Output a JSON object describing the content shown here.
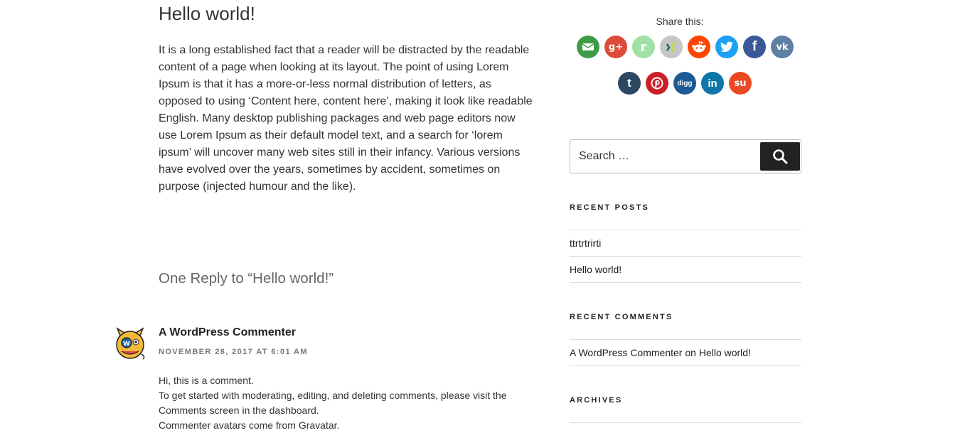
{
  "post": {
    "title": "Hello world!",
    "body": "It is a long established fact that a reader will be distracted by the readable content of a page when looking at its layout. The point of using Lorem Ipsum is that it has a more-or-less normal distribution of letters, as opposed to using ‘Content here, content here’, making it look like readable English. Many desktop publishing packages and web page editors now use Lorem Ipsum as their default model text, and a search for ‘lorem ipsum’ will uncover many web sites still in their infancy. Various versions have evolved over the years, sometimes by accident, sometimes on purpose (injected humour and the like)."
  },
  "comments": {
    "title": "One Reply to “Hello world!”",
    "items": [
      {
        "author": "A WordPress Commenter",
        "date": "November 28, 2017 at 6:01 am",
        "lines": [
          "Hi, this is a comment.",
          "To get started with moderating, editing, and deleting comments, please visit the Comments screen in the dashboard.",
          "Commenter avatars come from Gravatar."
        ]
      }
    ]
  },
  "share": {
    "title": "Share this:",
    "buttons": [
      {
        "name": "email",
        "color": "#3e9b46",
        "glyph": "✉"
      },
      {
        "name": "google-plus",
        "color": "#dd4b39",
        "glyph": "g+"
      },
      {
        "name": "renren",
        "color": "#a2e1a5",
        "glyph": "r"
      },
      {
        "name": "xing",
        "color": "#c6c6c6",
        "glyph": "x"
      },
      {
        "name": "reddit",
        "color": "#ff4500",
        "glyph": "●"
      },
      {
        "name": "twitter",
        "color": "#1da1f2",
        "glyph": "t"
      },
      {
        "name": "facebook",
        "color": "#3b5998",
        "glyph": "f"
      },
      {
        "name": "vk",
        "color": "#5d7fa3",
        "glyph": "vk"
      },
      {
        "name": "tumblr",
        "color": "#2c4762",
        "glyph": "t"
      },
      {
        "name": "pinterest",
        "color": "#cb2027",
        "glyph": "P"
      },
      {
        "name": "digg",
        "color": "#1d5a94",
        "glyph": "digg"
      },
      {
        "name": "linkedin",
        "color": "#0e76a8",
        "glyph": "in"
      },
      {
        "name": "stumbleupon",
        "color": "#eb4924",
        "glyph": "su"
      }
    ]
  },
  "search": {
    "placeholder": "Search …"
  },
  "widgets": {
    "recent_posts": {
      "title": "Recent Posts",
      "items": [
        "ttrtrtrirti",
        "Hello world!"
      ]
    },
    "recent_comments": {
      "title": "Recent Comments",
      "items": [
        {
          "author": "A WordPress Commenter",
          "on": "on",
          "post": "Hello world!"
        }
      ]
    },
    "archives": {
      "title": "Archives"
    }
  }
}
